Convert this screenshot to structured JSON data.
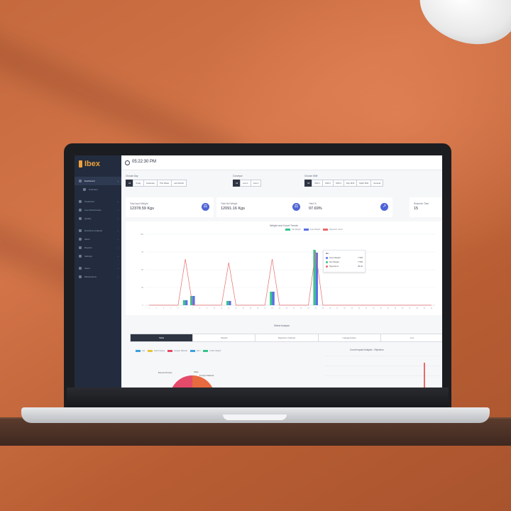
{
  "brand": {
    "name": "Ibex"
  },
  "topbar": {
    "time": "05:22:30 PM",
    "clock_icon": "clock-icon"
  },
  "sidebar": {
    "items": [
      {
        "label": "Dashboard",
        "active": true
      },
      {
        "label": "Overview",
        "sub": true
      },
      {
        "label": "Production"
      },
      {
        "label": "Line Performance"
      },
      {
        "label": "Quality"
      },
      {
        "label": "Downtime Analysis"
      },
      {
        "label": "Alerts"
      },
      {
        "label": "Reports"
      },
      {
        "label": "Settings"
      },
      {
        "label": "Users"
      },
      {
        "label": "Maintenance"
      }
    ]
  },
  "filters": {
    "groups": [
      {
        "label": "Choose Day",
        "options": [
          "All",
          "Today",
          "Yesterday",
          "This Week",
          "Last Month"
        ],
        "selected": 0
      },
      {
        "label": "Conveyor",
        "options": [
          "All",
          "Line 1",
          "Line 2"
        ],
        "selected": 0
      },
      {
        "label": "Choose Shift",
        "options": [
          "All",
          "Shift 1",
          "Shift 2",
          "Shift 3",
          "Day Shift",
          "Night Shift",
          "General"
        ],
        "selected": 0
      }
    ]
  },
  "stats": [
    {
      "label": "Total Input Weight",
      "value": "12378.59 Kgs",
      "icon": "scale-icon"
    },
    {
      "label": "Total Net Weight",
      "value": "12091.16 Kgs",
      "icon": "scale-icon"
    },
    {
      "label": "Yield %",
      "value": "97.69%",
      "icon": "trend-up-icon"
    },
    {
      "label": "Rejection Total",
      "value": "15",
      "icon": ""
    }
  ],
  "chart": {
    "title": "Weight and Count Trends",
    "legend": [
      {
        "name": "Net Weight",
        "color": "#35c48a"
      },
      {
        "name": "Input Weight",
        "color": "#5b6ee6"
      },
      {
        "name": "Rejection Count",
        "color": "#e86a6a"
      }
    ],
    "tooltip": {
      "title": "Bin",
      "rows": [
        {
          "name": "Input Weight",
          "value": "7.505",
          "color": "#5b6ee6"
        },
        {
          "name": "Net Weight",
          "value": "7.505",
          "color": "#35c48a"
        },
        {
          "name": "Rejections",
          "value": "48.46",
          "color": "#e86a6a"
        }
      ]
    }
  },
  "chart_data": {
    "type": "bar",
    "title": "Weight and Count Trends",
    "categories": [
      "1",
      "2",
      "3",
      "4",
      "5",
      "6",
      "7",
      "8",
      "9",
      "10",
      "11",
      "12",
      "13",
      "14",
      "15",
      "16",
      "17",
      "18",
      "19",
      "20",
      "21",
      "22",
      "23",
      "24",
      "25",
      "26",
      "27",
      "28",
      "29",
      "30",
      "31",
      "32",
      "33",
      "34",
      "35",
      "36",
      "37",
      "38",
      "39",
      "40"
    ],
    "series": [
      {
        "name": "Net Weight",
        "color": "#35c48a",
        "values": [
          0,
          0,
          0,
          0,
          0,
          7,
          13,
          0,
          0,
          0,
          0,
          6,
          0,
          0,
          0,
          0,
          0,
          19,
          0,
          0,
          0,
          0,
          0,
          78,
          0,
          0,
          0,
          0,
          0,
          0,
          0,
          0,
          0,
          0,
          0,
          0,
          0,
          0,
          0,
          0
        ]
      },
      {
        "name": "Input Weight",
        "color": "#5b6ee6",
        "values": [
          0,
          0,
          0,
          0,
          0,
          7,
          13,
          0,
          0,
          0,
          0,
          6,
          0,
          0,
          0,
          0,
          0,
          19,
          0,
          0,
          0,
          0,
          0,
          74,
          0,
          0,
          0,
          0,
          0,
          0,
          0,
          0,
          0,
          0,
          0,
          0,
          0,
          0,
          0,
          0
        ]
      },
      {
        "name": "Rejection Count",
        "color": "#e86a6a",
        "values": [
          0,
          0,
          0,
          0,
          0,
          65,
          0,
          0,
          0,
          0,
          0,
          60,
          0,
          0,
          0,
          0,
          0,
          65,
          0,
          0,
          0,
          0,
          0,
          76,
          0,
          0,
          0,
          0,
          0,
          0,
          0,
          0,
          0,
          0,
          0,
          0,
          0,
          0,
          0,
          0
        ]
      }
    ],
    "ylim": [
      0,
      100
    ]
  },
  "defect": {
    "title": "Defect Analysis",
    "tabs": [
      "Table",
      "Weight",
      "Rejection Analysis",
      "Categorization",
      "Line"
    ],
    "selected_tab": 0,
    "pie_legend": [
      {
        "name": "Gel",
        "color": "#3aa0e0"
      },
      {
        "name": "Seal Integrity",
        "color": "#e8c43c"
      },
      {
        "name": "Foreign Material",
        "color": "#e44a6a"
      },
      {
        "name": "Dent",
        "color": "#3aa0e0"
      },
      {
        "name": "Under Weight",
        "color": "#35c48a"
      }
    ],
    "pie_labels": {
      "left": "Burned Product",
      "right": "Stale",
      "right2": "Foreign Material"
    },
    "pareto_title": "Count Impact Analysis - Rejection"
  }
}
